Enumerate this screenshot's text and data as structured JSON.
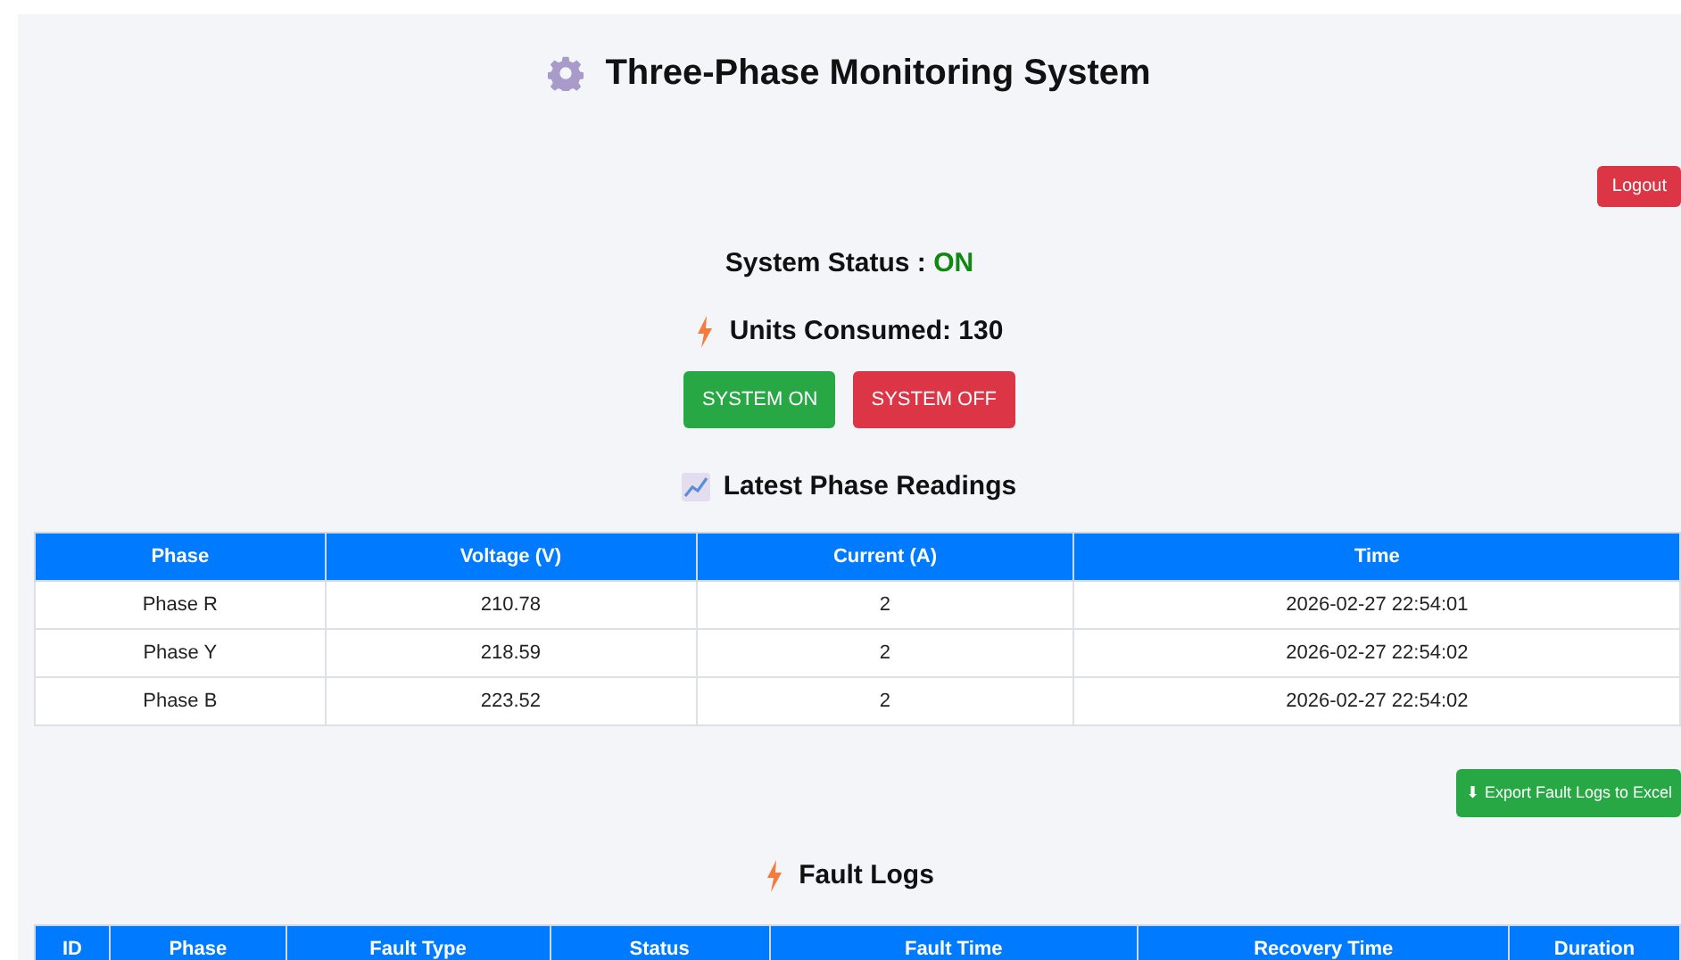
{
  "title": "Three-Phase Monitoring System",
  "logout": "Logout",
  "status": {
    "label": "System Status :",
    "value": "ON",
    "on": true
  },
  "units": "Units Consumed: 130",
  "buttons": [
    {
      "label": "SYSTEM ON",
      "kind": "on"
    },
    {
      "label": "SYSTEM OFF",
      "kind": "off"
    }
  ],
  "readings": {
    "title": "Latest Phase Readings",
    "columns": [
      "Phase",
      "Voltage (V)",
      "Current (A)",
      "Time"
    ],
    "rows": [
      [
        "Phase R",
        "210.78",
        "2",
        "2026-02-27 22:54:01"
      ],
      [
        "Phase Y",
        "218.59",
        "2",
        "2026-02-27 22:54:02"
      ],
      [
        "Phase B",
        "223.52",
        "2",
        "2026-02-27 22:54:02"
      ]
    ]
  },
  "export": "⬇ Export Fault Logs to Excel",
  "fault_logs": {
    "title": "Fault Logs",
    "columns": [
      "ID",
      "Phase",
      "Fault Type",
      "Status",
      "Fault Time",
      "Recovery Time",
      "Duration"
    ]
  }
}
